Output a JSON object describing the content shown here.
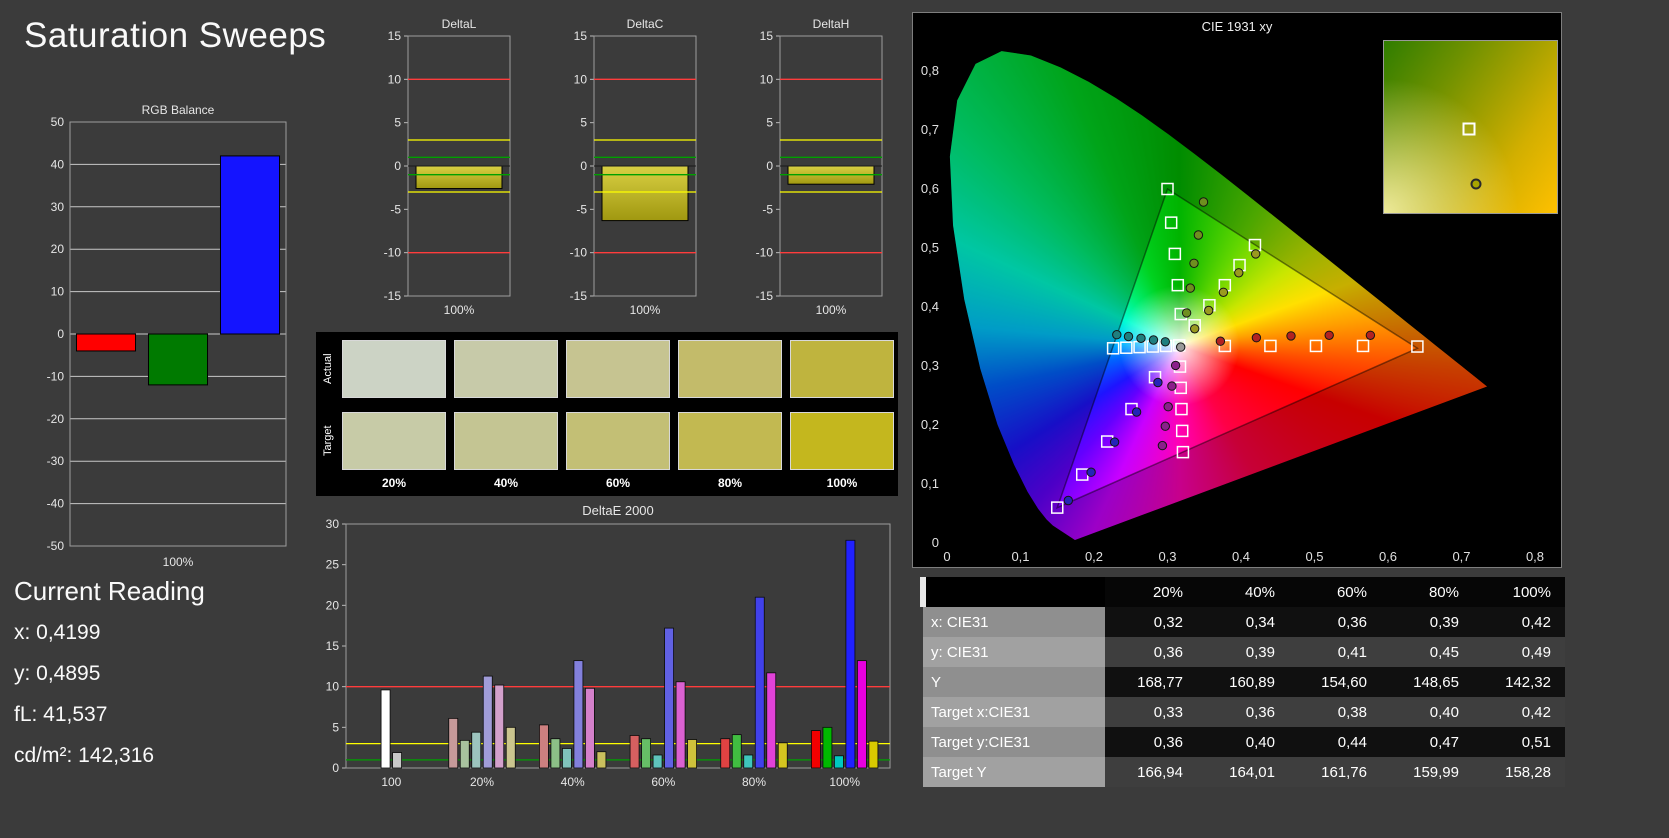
{
  "page": {
    "title": "Saturation Sweeps"
  },
  "current_reading": {
    "heading": "Current Reading",
    "lines": [
      "x: 0,4199",
      "y: 0,4895",
      "fL: 41,537",
      "cd/m²: 142,316"
    ]
  },
  "chart_data": [
    {
      "id": "rgb_balance",
      "type": "bar",
      "title": "RGB Balance",
      "xlabel": "100%",
      "ylim": [
        -50,
        50
      ],
      "yticks": [
        50,
        40,
        30,
        20,
        10,
        0,
        -10,
        -20,
        -30,
        -40,
        -50
      ],
      "series": [
        {
          "name": "red",
          "color": "#ff0000",
          "value": -4
        },
        {
          "name": "green",
          "color": "#007a00",
          "value": -12
        },
        {
          "name": "blue",
          "color": "#1414ff",
          "value": 42
        }
      ]
    },
    {
      "id": "delta_l",
      "type": "bar",
      "title": "DeltaL",
      "xlabel": "100%",
      "ylim": [
        -15,
        15
      ],
      "yticks": [
        15,
        10,
        5,
        0,
        -5,
        -10,
        -15
      ],
      "value": -2.6,
      "ref_lines": [
        {
          "y": 10,
          "color": "#ff3c3c"
        },
        {
          "y": 3,
          "color": "#ffff00"
        },
        {
          "y": 1,
          "color": "#00a000"
        },
        {
          "y": -1,
          "color": "#00a000"
        },
        {
          "y": -3,
          "color": "#ffff00"
        },
        {
          "y": -10,
          "color": "#ff3c3c"
        }
      ]
    },
    {
      "id": "delta_c",
      "type": "bar",
      "title": "DeltaC",
      "xlabel": "100%",
      "ylim": [
        -15,
        15
      ],
      "yticks": [
        15,
        10,
        5,
        0,
        -5,
        -10,
        -15
      ],
      "value": -6.3,
      "ref_lines": [
        {
          "y": 10,
          "color": "#ff3c3c"
        },
        {
          "y": 3,
          "color": "#ffff00"
        },
        {
          "y": 1,
          "color": "#00a000"
        },
        {
          "y": -1,
          "color": "#00a000"
        },
        {
          "y": -3,
          "color": "#ffff00"
        },
        {
          "y": -10,
          "color": "#ff3c3c"
        }
      ]
    },
    {
      "id": "delta_h",
      "type": "bar",
      "title": "DeltaH",
      "xlabel": "100%",
      "ylim": [
        -15,
        15
      ],
      "yticks": [
        15,
        10,
        5,
        0,
        -5,
        -10,
        -15
      ],
      "value": -2.1,
      "ref_lines": [
        {
          "y": 10,
          "color": "#ff3c3c"
        },
        {
          "y": 3,
          "color": "#ffff00"
        },
        {
          "y": 1,
          "color": "#00a000"
        },
        {
          "y": -1,
          "color": "#00a000"
        },
        {
          "y": -3,
          "color": "#ffff00"
        },
        {
          "y": -10,
          "color": "#ff3c3c"
        }
      ]
    },
    {
      "id": "deltae2000",
      "type": "bar",
      "title": "DeltaE 2000",
      "ylim": [
        0,
        30
      ],
      "yticks": [
        0,
        5,
        10,
        15,
        20,
        25,
        30
      ],
      "ref_lines": [
        {
          "y": 10,
          "color": "#ff3c3c"
        },
        {
          "y": 3,
          "color": "#ffff00"
        },
        {
          "y": 1,
          "color": "#00a000"
        }
      ],
      "groups": [
        {
          "label": "100",
          "bars": [
            {
              "color": "#ffffff",
              "value": 9.6
            },
            {
              "color": "#c8c8c8",
              "value": 1.9
            }
          ]
        },
        {
          "label": "20%",
          "bars": [
            {
              "color": "#c79a9a",
              "value": 6.1
            },
            {
              "color": "#a8c29e",
              "value": 3.4
            },
            {
              "color": "#9cc4be",
              "value": 4.4
            },
            {
              "color": "#a09cd8",
              "value": 11.3
            },
            {
              "color": "#d2a0cb",
              "value": 10.2
            },
            {
              "color": "#cbc58f",
              "value": 5.0
            }
          ]
        },
        {
          "label": "40%",
          "bars": [
            {
              "color": "#cd8080",
              "value": 5.3
            },
            {
              "color": "#8cc087",
              "value": 3.6
            },
            {
              "color": "#80c2bb",
              "value": 2.4
            },
            {
              "color": "#8280dc",
              "value": 13.2
            },
            {
              "color": "#d480ca",
              "value": 9.8
            },
            {
              "color": "#cac05e",
              "value": 2.0
            }
          ]
        },
        {
          "label": "60%",
          "bars": [
            {
              "color": "#d66060",
              "value": 4.0
            },
            {
              "color": "#66bd66",
              "value": 3.6
            },
            {
              "color": "#5fc4bc",
              "value": 1.6
            },
            {
              "color": "#6161e3",
              "value": 17.2
            },
            {
              "color": "#da61d1",
              "value": 10.6
            },
            {
              "color": "#cfc23b",
              "value": 3.5
            }
          ]
        },
        {
          "label": "80%",
          "bars": [
            {
              "color": "#e14242",
              "value": 3.6
            },
            {
              "color": "#41bd41",
              "value": 4.1
            },
            {
              "color": "#3fc6bd",
              "value": 1.6
            },
            {
              "color": "#4141ea",
              "value": 21.0
            },
            {
              "color": "#e142d8",
              "value": 11.7
            },
            {
              "color": "#d4c520",
              "value": 3.1
            }
          ]
        },
        {
          "label": "100%",
          "bars": [
            {
              "color": "#f20000",
              "value": 4.6
            },
            {
              "color": "#00b900",
              "value": 5.0
            },
            {
              "color": "#00c9c0",
              "value": 1.5
            },
            {
              "color": "#2121ff",
              "value": 28.0
            },
            {
              "color": "#e800df",
              "value": 13.2
            },
            {
              "color": "#d9c900",
              "value": 3.3
            }
          ]
        }
      ]
    },
    {
      "id": "cie1931",
      "type": "scatter",
      "title": "CIE 1931 xy",
      "xlim": [
        0,
        0.8
      ],
      "ylim": [
        0,
        0.85
      ],
      "xticks": [
        "0",
        "0,1",
        "0,2",
        "0,3",
        "0,4",
        "0,5",
        "0,6",
        "0,7",
        "0,8"
      ],
      "yticks": [
        "0",
        "0,1",
        "0,2",
        "0,3",
        "0,4",
        "0,5",
        "0,6",
        "0,7",
        "0,8"
      ],
      "gamut_triangle": [
        [
          0.64,
          0.33
        ],
        [
          0.3,
          0.6
        ],
        [
          0.15,
          0.06
        ]
      ],
      "target_series": [
        {
          "name": "white",
          "points": [
            [
              0.316,
              0.335
            ]
          ]
        },
        {
          "name": "red",
          "points": [
            [
              0.378,
              0.334
            ],
            [
              0.44,
              0.334
            ],
            [
              0.502,
              0.334
            ],
            [
              0.566,
              0.334
            ],
            [
              0.64,
              0.333
            ]
          ]
        },
        {
          "name": "green",
          "points": [
            [
              0.318,
              0.388
            ],
            [
              0.314,
              0.437
            ],
            [
              0.31,
              0.49
            ],
            [
              0.305,
              0.543
            ],
            [
              0.3,
              0.6
            ]
          ]
        },
        {
          "name": "blue",
          "points": [
            [
              0.283,
              0.281
            ],
            [
              0.251,
              0.227
            ],
            [
              0.218,
              0.172
            ],
            [
              0.184,
              0.116
            ],
            [
              0.15,
              0.06
            ]
          ]
        },
        {
          "name": "cyan",
          "points": [
            [
              0.298,
              0.334
            ],
            [
              0.28,
              0.333
            ],
            [
              0.262,
              0.332
            ],
            [
              0.244,
              0.331
            ],
            [
              0.226,
              0.33
            ]
          ]
        },
        {
          "name": "magenta",
          "points": [
            [
              0.317,
              0.299
            ],
            [
              0.318,
              0.263
            ],
            [
              0.319,
              0.227
            ],
            [
              0.32,
              0.19
            ],
            [
              0.321,
              0.154
            ]
          ]
        },
        {
          "name": "yellow",
          "points": [
            [
              0.337,
              0.369
            ],
            [
              0.357,
              0.403
            ],
            [
              0.378,
              0.437
            ],
            [
              0.398,
              0.471
            ],
            [
              0.419,
              0.505
            ]
          ]
        }
      ],
      "measurement_series": [
        {
          "name": "white",
          "color": "#9a9a9a",
          "points": [
            [
              0.318,
              0.332
            ]
          ]
        },
        {
          "name": "red",
          "color": "#b22222",
          "points": [
            [
              0.372,
              0.342
            ],
            [
              0.421,
              0.348
            ],
            [
              0.468,
              0.351
            ],
            [
              0.52,
              0.352
            ],
            [
              0.576,
              0.352
            ]
          ]
        },
        {
          "name": "green",
          "color": "#6f8f1f",
          "points": [
            [
              0.326,
              0.39
            ],
            [
              0.331,
              0.432
            ],
            [
              0.336,
              0.474
            ],
            [
              0.342,
              0.522
            ],
            [
              0.349,
              0.578
            ]
          ]
        },
        {
          "name": "blue",
          "color": "#2424b8",
          "points": [
            [
              0.287,
              0.272
            ],
            [
              0.258,
              0.222
            ],
            [
              0.228,
              0.171
            ],
            [
              0.196,
              0.12
            ],
            [
              0.165,
              0.072
            ]
          ]
        },
        {
          "name": "cyan",
          "color": "#1f7f7f",
          "points": [
            [
              0.297,
              0.341
            ],
            [
              0.281,
              0.344
            ],
            [
              0.264,
              0.347
            ],
            [
              0.247,
              0.35
            ],
            [
              0.231,
              0.353
            ]
          ]
        },
        {
          "name": "magenta",
          "color": "#8b1f8b",
          "points": [
            [
              0.311,
              0.301
            ],
            [
              0.306,
              0.266
            ],
            [
              0.301,
              0.231
            ],
            [
              0.297,
              0.198
            ],
            [
              0.293,
              0.165
            ]
          ]
        },
        {
          "name": "yellow",
          "color": "#9a9a1f",
          "points": [
            [
              0.337,
              0.363
            ],
            [
              0.356,
              0.394
            ],
            [
              0.376,
              0.425
            ],
            [
              0.397,
              0.458
            ],
            [
              0.42,
              0.49
            ]
          ]
        }
      ],
      "inset": {
        "square": [
          49,
          51
        ],
        "dot": [
          53,
          83
        ],
        "dot_color": "#a8a400"
      }
    }
  ],
  "swatches": {
    "row_labels": [
      "Actual",
      "Target"
    ],
    "col_labels": [
      "20%",
      "40%",
      "60%",
      "80%",
      "100%"
    ],
    "actual": [
      "#ccd3c5",
      "#c7caa9",
      "#c6c491",
      "#c3bb6a",
      "#bfb43e"
    ],
    "target": [
      "#c7cba7",
      "#c4c593",
      "#c3bf75",
      "#c2b951",
      "#c4b71e"
    ]
  },
  "table": {
    "columns": [
      "",
      "20%",
      "40%",
      "60%",
      "80%",
      "100%"
    ],
    "rows": [
      {
        "label": "x: CIE31",
        "values": [
          "0,32",
          "0,34",
          "0,36",
          "0,39",
          "0,42"
        ]
      },
      {
        "label": "y: CIE31",
        "values": [
          "0,36",
          "0,39",
          "0,41",
          "0,45",
          "0,49"
        ]
      },
      {
        "label": "Y",
        "values": [
          "168,77",
          "160,89",
          "154,60",
          "148,65",
          "142,32"
        ]
      },
      {
        "label": "Target x:CIE31",
        "values": [
          "0,33",
          "0,36",
          "0,38",
          "0,40",
          "0,42"
        ]
      },
      {
        "label": "Target y:CIE31",
        "values": [
          "0,36",
          "0,40",
          "0,44",
          "0,47",
          "0,51"
        ]
      },
      {
        "label": "Target Y",
        "values": [
          "166,94",
          "164,01",
          "161,76",
          "159,99",
          "158,28"
        ]
      }
    ]
  }
}
